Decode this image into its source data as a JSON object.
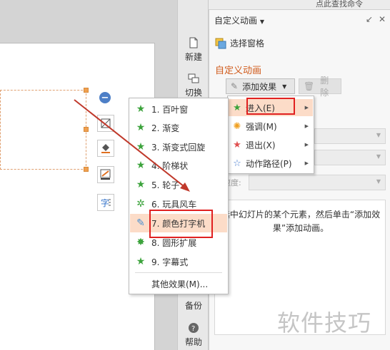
{
  "vtoolbar": {
    "new_label": "新建",
    "switch_label": "切换",
    "backup_label": "备份",
    "help_label": "帮助"
  },
  "panel": {
    "title": "自定义动画",
    "select_pane_label": "选择窗格",
    "section_title": "自定义动画",
    "add_effect_label": "添加效果",
    "delete_label": "删除",
    "speed_label": "速度:",
    "hint_text": "选中幻灯片的某个元素，然后单击“添加效果”添加动画。",
    "topbar_partial_text": "点此查找命令"
  },
  "submenu": {
    "items": [
      {
        "label": "进入(E)",
        "icon": "star-green-icon"
      },
      {
        "label": "强调(M)",
        "icon": "sun-burst-icon"
      },
      {
        "label": "退出(X)",
        "icon": "star-red-icon"
      },
      {
        "label": "动作路径(P)",
        "icon": "star-outline-icon"
      }
    ]
  },
  "effects_menu": {
    "items": [
      {
        "label": "1. 百叶窗"
      },
      {
        "label": "2. 渐变"
      },
      {
        "label": "3. 渐变式回旋"
      },
      {
        "label": "4. 阶梯状"
      },
      {
        "label": "5. 轮子"
      },
      {
        "label": "6. 玩具风车"
      },
      {
        "label": "7. 颜色打字机"
      },
      {
        "label": "8. 圆形扩展"
      },
      {
        "label": "9. 字幕式"
      }
    ],
    "more_label": "其他效果(M)..."
  },
  "watermark": "软件技巧",
  "colors": {
    "accent_orange": "#d05a1a",
    "highlight_red": "#e02020",
    "hover_bg": "#fcdcc8"
  }
}
